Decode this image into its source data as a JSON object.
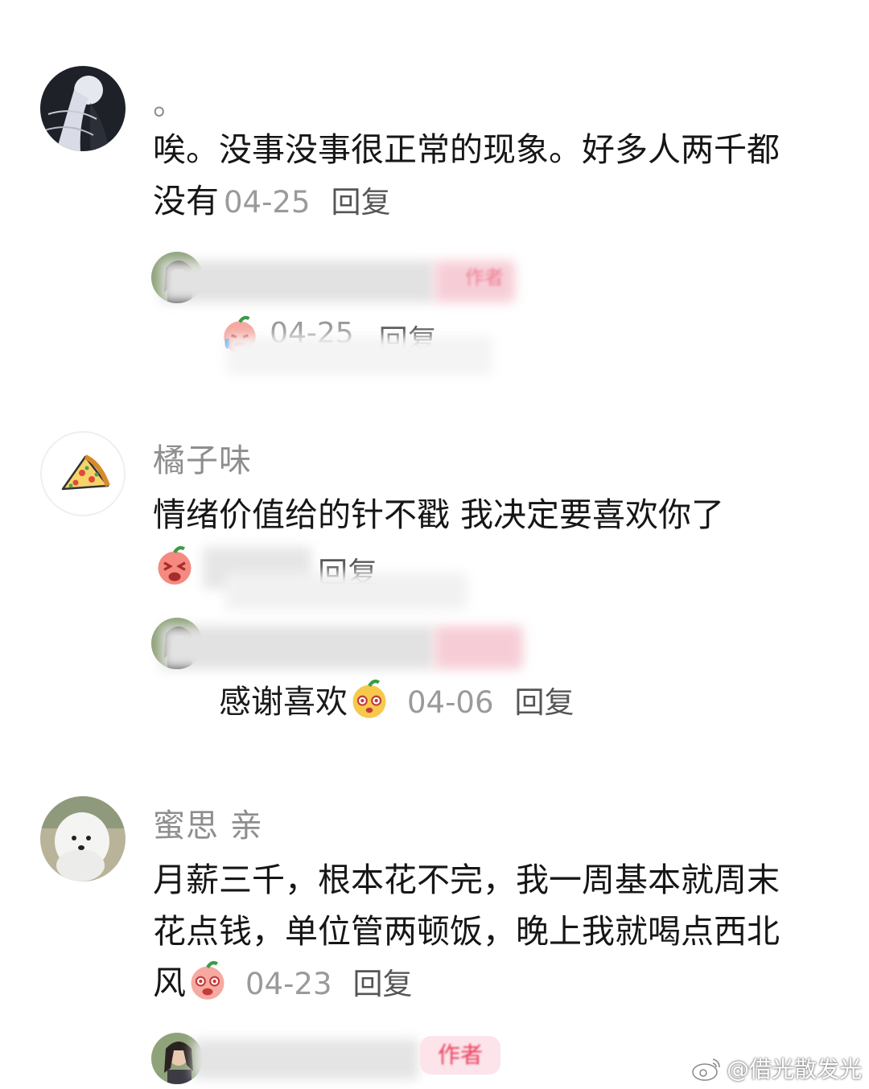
{
  "comments": [
    {
      "username": "。",
      "text": "唉。没事没事很正常的现象。好多人两千都没有",
      "date": "04-25",
      "reply_label": "回复",
      "avatar_icon": "anime-girl-avatar-icon",
      "reply": {
        "author_badge": "作者",
        "date": "04-25",
        "reply_label": "回复"
      }
    },
    {
      "username": "橘子味",
      "text": "情绪价值给的针不戳 我决定要喜欢你了",
      "reply_label": "回复",
      "avatar_icon": "pizza-avatar-icon",
      "reply": {
        "text": "感谢喜欢",
        "date": "04-06",
        "reply_label": "回复"
      }
    },
    {
      "username": "蜜思 亲",
      "text": "月薪三千，根本花不完，我一周基本就周末花点钱，单位管两顿饭，晚上我就喝点西北风",
      "date": "04-23",
      "reply_label": "回复",
      "avatar_icon": "white-dog-avatar-icon",
      "reply": {
        "author_badge": "作者"
      }
    }
  ],
  "watermark": "@借光散发光",
  "colors": {
    "author_badge_bg": "#fde3ea",
    "author_badge_text": "#e8405d",
    "meta_gray": "#9a9a9a"
  }
}
